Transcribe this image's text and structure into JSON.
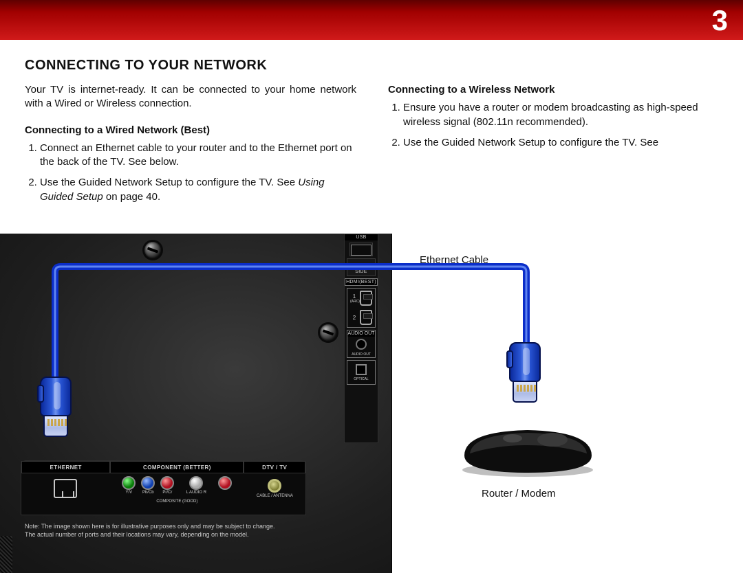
{
  "chapter_number": "3",
  "section_title": "CONNECTING TO YOUR NETWORK",
  "intro": "Your TV is internet-ready. It can be connected to your home network with a Wired or Wireless connection.",
  "left": {
    "subhead": "Connecting to a Wired Network (Best)",
    "step1": "Connect an Ethernet cable to your router and to the Ethernet port on the back of the TV. See below.",
    "step2_a": "Use the Guided Network Setup to configure the TV. See ",
    "step2_ital": "Using Guided Setup",
    "step2_b": " on page 40."
  },
  "right": {
    "subhead": "Connecting to a Wireless Network",
    "step1": "Ensure you have a router or modem broadcasting as high-speed wireless signal (802.11n recommended).",
    "step2": "Use the Guided Network Setup to configure the TV. See"
  },
  "labels": {
    "ethernet_cable": "Ethernet Cable",
    "router_modem": "Router / Modem"
  },
  "ports": {
    "usb": "USB",
    "side": "SIDE",
    "hdmi_best": "HDMI(BEST)",
    "hdmi1_sub": "(ARC)",
    "hdmi1_num": "1",
    "hdmi2_num": "2",
    "audio_out_box": "AUDIO OUT",
    "audio_out_small": "AUDIO OUT",
    "optical": "OPTICAL",
    "ethernet": "ETHERNET",
    "component_better": "COMPONENT (BETTER)",
    "dtv_tv": "DTV / TV",
    "yv": "Y/V",
    "pbcb": "Pb/Cb",
    "prcr": "Pr/Cr",
    "laudio": "L   AUDIO   R",
    "composite_good": "COMPOSITE (GOOD)",
    "cable_antenna": "CABLE / ANTENNA"
  },
  "note_line1": "Note:  The image shown here is for illustrative purposes only and may be subject to change.",
  "note_line2": "The actual number of ports and their locations may vary, depending on the model."
}
